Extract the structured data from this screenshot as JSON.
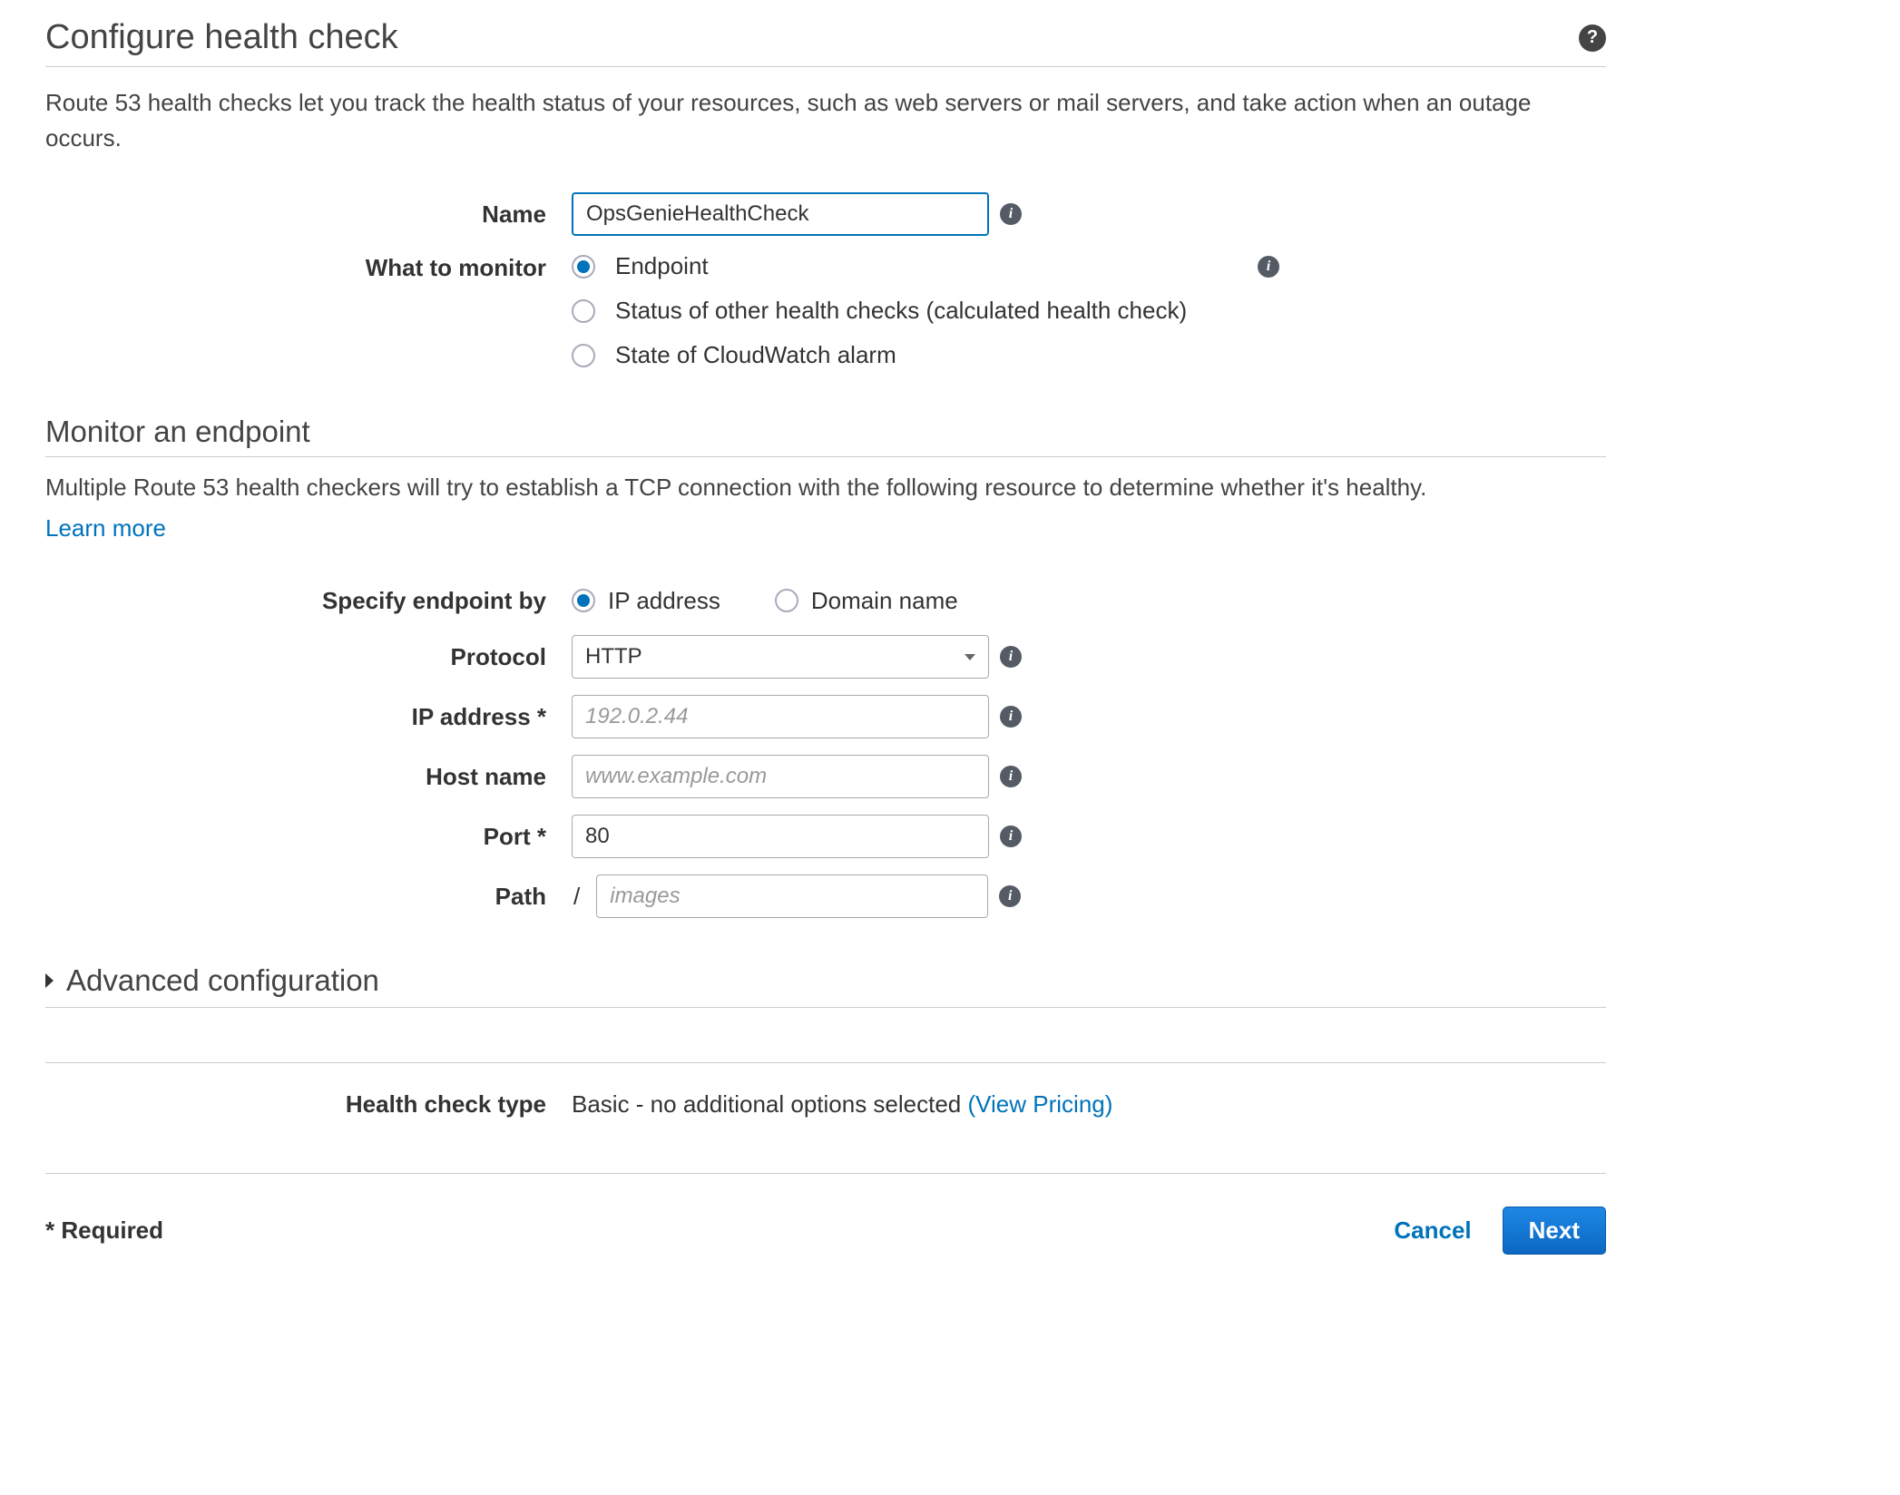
{
  "header": {
    "title": "Configure health check",
    "description": "Route 53 health checks let you track the health status of your resources, such as web servers or mail servers, and take action when an outage occurs."
  },
  "form": {
    "name_label": "Name",
    "name_value": "OpsGenieHealthCheck",
    "monitor_label": "What to monitor",
    "monitor_options": {
      "endpoint": "Endpoint",
      "calculated": "Status of other health checks (calculated health check)",
      "cloudwatch": "State of CloudWatch alarm"
    }
  },
  "endpoint": {
    "title": "Monitor an endpoint",
    "description": "Multiple Route 53 health checkers will try to establish a TCP connection with the following resource to determine whether it's healthy.",
    "learn_more": "Learn more",
    "specify_label": "Specify endpoint by",
    "specify_ip": "IP address",
    "specify_domain": "Domain name",
    "protocol_label": "Protocol",
    "protocol_value": "HTTP",
    "ip_label": "IP address *",
    "ip_placeholder": "192.0.2.44",
    "host_label": "Host name",
    "host_placeholder": "www.example.com",
    "port_label": "Port *",
    "port_value": "80",
    "path_label": "Path",
    "path_prefix": "/",
    "path_placeholder": "images"
  },
  "advanced": {
    "title": "Advanced configuration"
  },
  "type": {
    "label": "Health check type",
    "value": "Basic - no additional options selected ",
    "pricing_link": "(View Pricing)"
  },
  "footer": {
    "required": "* Required",
    "cancel": "Cancel",
    "next": "Next"
  }
}
